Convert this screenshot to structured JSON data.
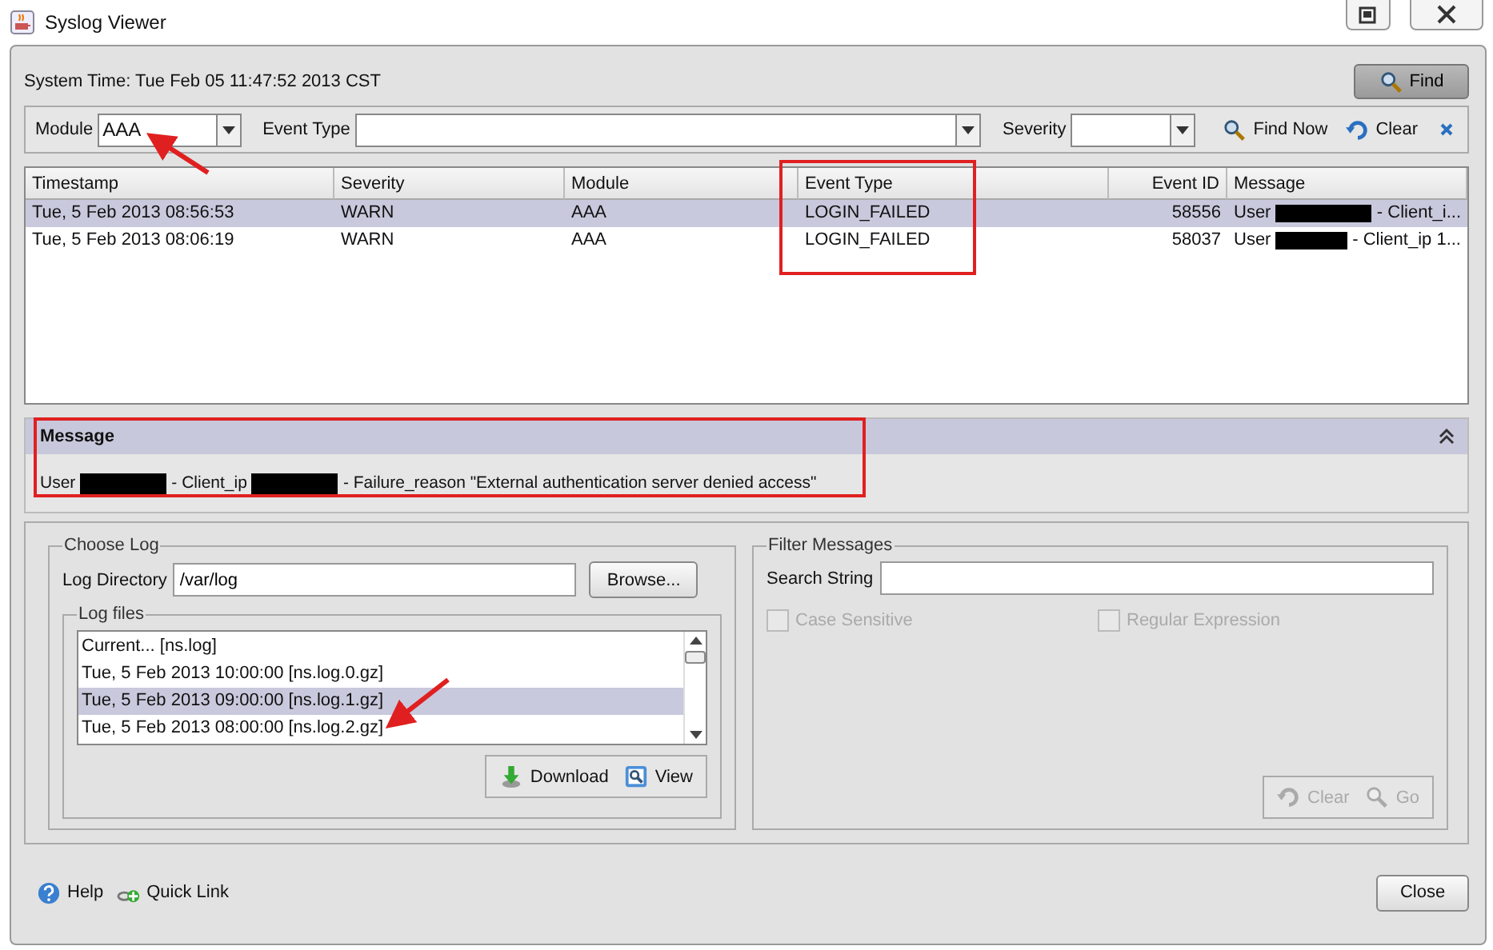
{
  "window": {
    "title": "Syslog Viewer"
  },
  "system_time": "System Time: Tue Feb 05 11:47:52 2013 CST",
  "find_button": "Find",
  "filters": {
    "module": {
      "label": "Module",
      "value": "AAA"
    },
    "event_type": {
      "label": "Event Type"
    },
    "severity": {
      "label": "Severity"
    },
    "find_now": "Find Now",
    "clear": "Clear"
  },
  "table": {
    "columns": [
      "Timestamp",
      "Severity",
      "Module",
      "Event Type",
      "Event ID",
      "Message"
    ],
    "rows": [
      {
        "selected": true,
        "timestamp": "Tue, 5 Feb 2013 08:56:53",
        "severity": "WARN",
        "module": "AAA",
        "event_type": "LOGIN_FAILED",
        "event_id": "58556",
        "message": [
          {
            "kind": "text",
            "text": "User"
          },
          {
            "kind": "redacted"
          },
          {
            "kind": "text",
            "text": "- Client_i..."
          }
        ]
      },
      {
        "selected": false,
        "timestamp": "Tue, 5 Feb 2013 08:06:19",
        "severity": "WARN",
        "module": "AAA",
        "event_type": "LOGIN_FAILED",
        "event_id": "58037",
        "message": [
          {
            "kind": "text",
            "text": "User"
          },
          {
            "kind": "redacted"
          },
          {
            "kind": "text",
            "text": "- Client_ip 1..."
          }
        ]
      }
    ]
  },
  "message_panel": {
    "title": "Message",
    "message": [
      {
        "kind": "text",
        "text": "User"
      },
      {
        "kind": "redacted"
      },
      {
        "kind": "text",
        "text": "- Client_ip"
      },
      {
        "kind": "redacted"
      },
      {
        "kind": "text",
        "text": "- Failure_reason \"External authentication server denied access\""
      }
    ]
  },
  "choose_log": {
    "title": "Choose Log",
    "directory_label": "Log Directory",
    "directory_value": "/var/log",
    "browse": "Browse...",
    "log_files_title": "Log files",
    "files": [
      {
        "label": "Current... [ns.log]",
        "selected": false
      },
      {
        "label": "Tue, 5 Feb 2013 10:00:00 [ns.log.0.gz]",
        "selected": false
      },
      {
        "label": "Tue, 5 Feb 2013 09:00:00 [ns.log.1.gz]",
        "selected": true
      },
      {
        "label": "Tue, 5 Feb 2013 08:00:00 [ns.log.2.gz]",
        "selected": false
      }
    ],
    "download": "Download",
    "view": "View"
  },
  "filter_messages": {
    "title": "Filter Messages",
    "search_label": "Search String",
    "options": [
      {
        "label": "Case Sensitive",
        "checked": false,
        "disabled": true
      },
      {
        "label": "Regular Expression",
        "checked": false,
        "disabled": true
      }
    ],
    "clear": {
      "label": "Clear",
      "disabled": true
    },
    "go": {
      "label": "Go",
      "disabled": true
    }
  },
  "footer": {
    "help": "Help",
    "quick_link": "Quick Link",
    "close": "Close"
  }
}
